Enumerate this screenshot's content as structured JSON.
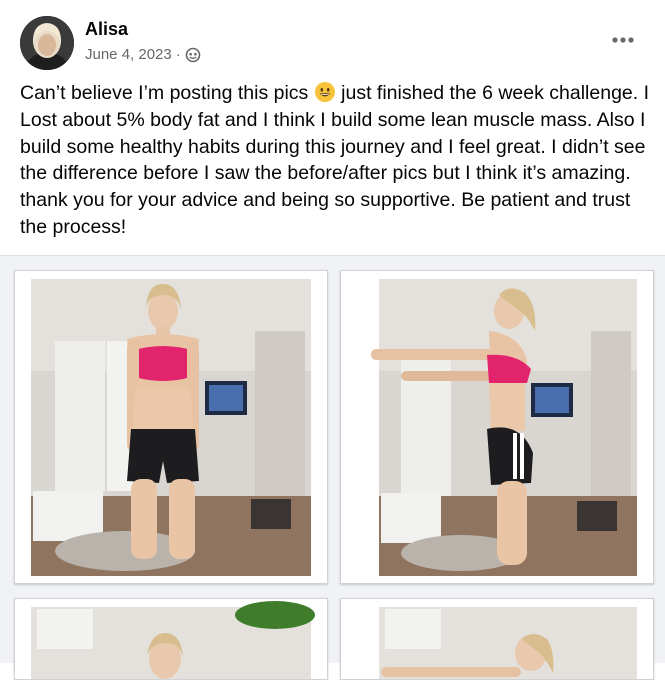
{
  "post": {
    "author": "Alisa",
    "date": "June 4, 2023",
    "separator": "·",
    "caption_part1": "Can’t believe I’m posting this pics",
    "caption_part2": " just finished the 6 week challenge. I Lost about 5% body fat and I think I build some lean muscle mass. Also I build some healthy habits during this journey and I feel great. I didn’t see the difference before I saw the before/after pics but I think it’s amazing. thank you for your advice and being so supportive. Be patient and trust the process!"
  },
  "icons": {
    "audience": "globe-icon",
    "menu": "more-options-icon",
    "emoji": "grinning-face-emoji"
  },
  "colors": {
    "text": "#050505",
    "secondary": "#65676b",
    "gallery_bg": "#f0f2f5",
    "sports_bra": "#e2246d"
  }
}
